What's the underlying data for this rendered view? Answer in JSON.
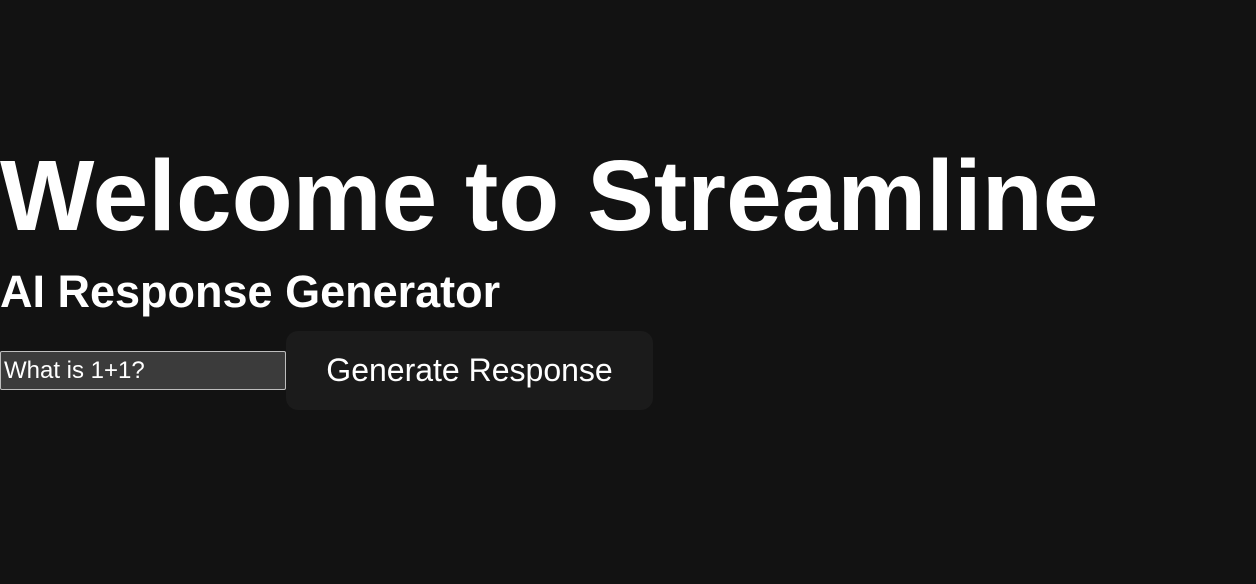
{
  "header": {
    "title": "Welcome to Streamline",
    "subtitle": "AI Response Generator"
  },
  "prompt": {
    "value": "What is 1+1?",
    "placeholder": ""
  },
  "actions": {
    "generate_label": "Generate Response"
  },
  "colors": {
    "background": "#121212",
    "text": "#ffffff",
    "input_background": "#3b3b3b",
    "button_background": "#1b1b1b"
  }
}
